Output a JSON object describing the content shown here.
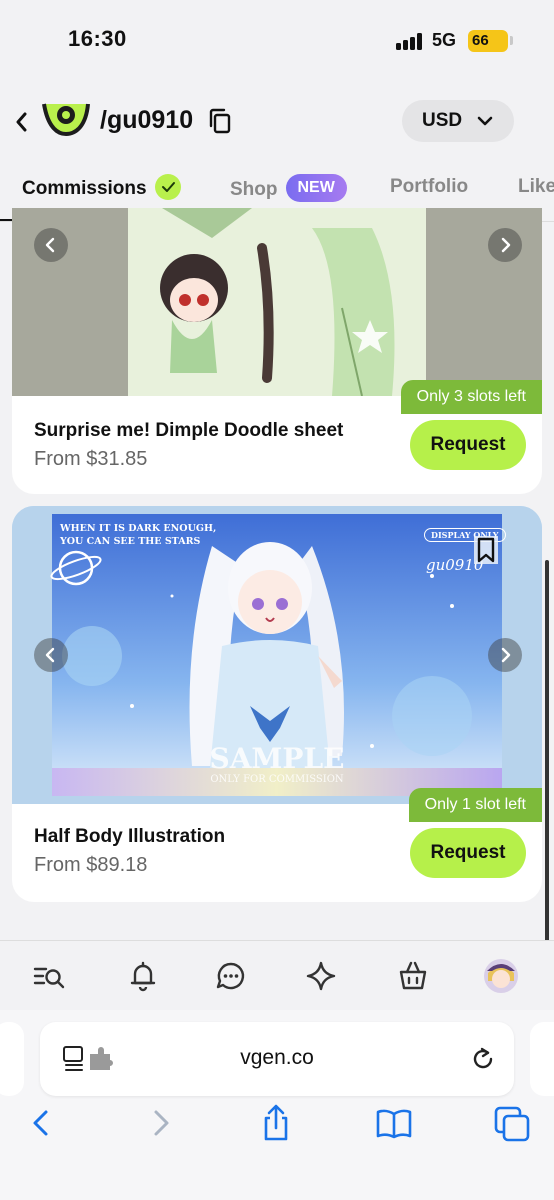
{
  "status": {
    "time": "16:30",
    "network": "5G",
    "battery": "66"
  },
  "header": {
    "username": "/gu0910",
    "currency": "USD"
  },
  "tabs": [
    {
      "label": "Commissions",
      "active": true
    },
    {
      "label": "Shop",
      "badge": "NEW"
    },
    {
      "label": "Portfolio"
    },
    {
      "label": "Like"
    }
  ],
  "cards": [
    {
      "title": "Surprise me! Dimple Doodle sheet",
      "price": "From $31.85",
      "slots": "Only 3 slots left",
      "request_label": "Request"
    },
    {
      "title": "Half Body Illustration",
      "price": "From $89.18",
      "slots": "Only 1 slot left",
      "request_label": "Request",
      "art": {
        "line1": "WHEN IT IS DARK ENOUGH,",
        "line2": "YOU CAN SEE THE STARS",
        "stamp": "DISPLAY ONLY",
        "signature": "gu0910",
        "sample": "SAMPLE",
        "sample_sub": "ONLY FOR COMMISSION"
      }
    }
  ],
  "browser": {
    "url": "vgen.co"
  },
  "colors": {
    "accent_green": "#b6f04a",
    "slots_green": "#7dba3a",
    "new_purple": "#8a72f0"
  },
  "icons": {
    "nav": [
      "search-list-icon",
      "bell-icon",
      "chat-icon",
      "sparkle-icon",
      "bag-icon",
      "avatar"
    ],
    "toolbar": [
      "back-icon",
      "forward-icon",
      "share-icon",
      "bookmarks-icon",
      "tabs-icon"
    ]
  }
}
